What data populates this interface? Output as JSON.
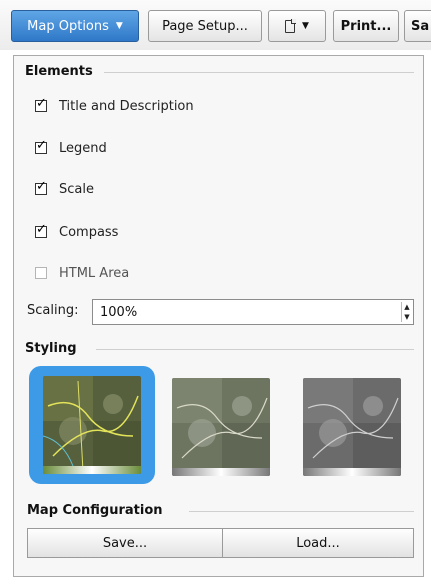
{
  "toolbar": {
    "map_options_label": "Map Options",
    "page_setup_label": "Page Setup...",
    "print_label": "Print...",
    "save_partial_label": "Sa",
    "accent_color": "#3a86d4"
  },
  "elements": {
    "title": "Elements",
    "items": [
      {
        "label": "Title and Description",
        "checked": true
      },
      {
        "label": "Legend",
        "checked": true
      },
      {
        "label": "Scale",
        "checked": true
      },
      {
        "label": "Compass",
        "checked": true
      },
      {
        "label": "HTML Area",
        "checked": false
      }
    ]
  },
  "scaling": {
    "label": "Scaling:",
    "value": "100%"
  },
  "styling": {
    "title": "Styling",
    "options": [
      {
        "selected": true,
        "icon": "satellite-map-thumbnail"
      },
      {
        "selected": false,
        "icon": "muted-map-thumbnail"
      },
      {
        "selected": false,
        "icon": "grayscale-map-thumbnail"
      }
    ],
    "selected_color": "#3c9ae6"
  },
  "map_configuration": {
    "title": "Map Configuration",
    "save_label": "Save...",
    "load_label": "Load..."
  }
}
